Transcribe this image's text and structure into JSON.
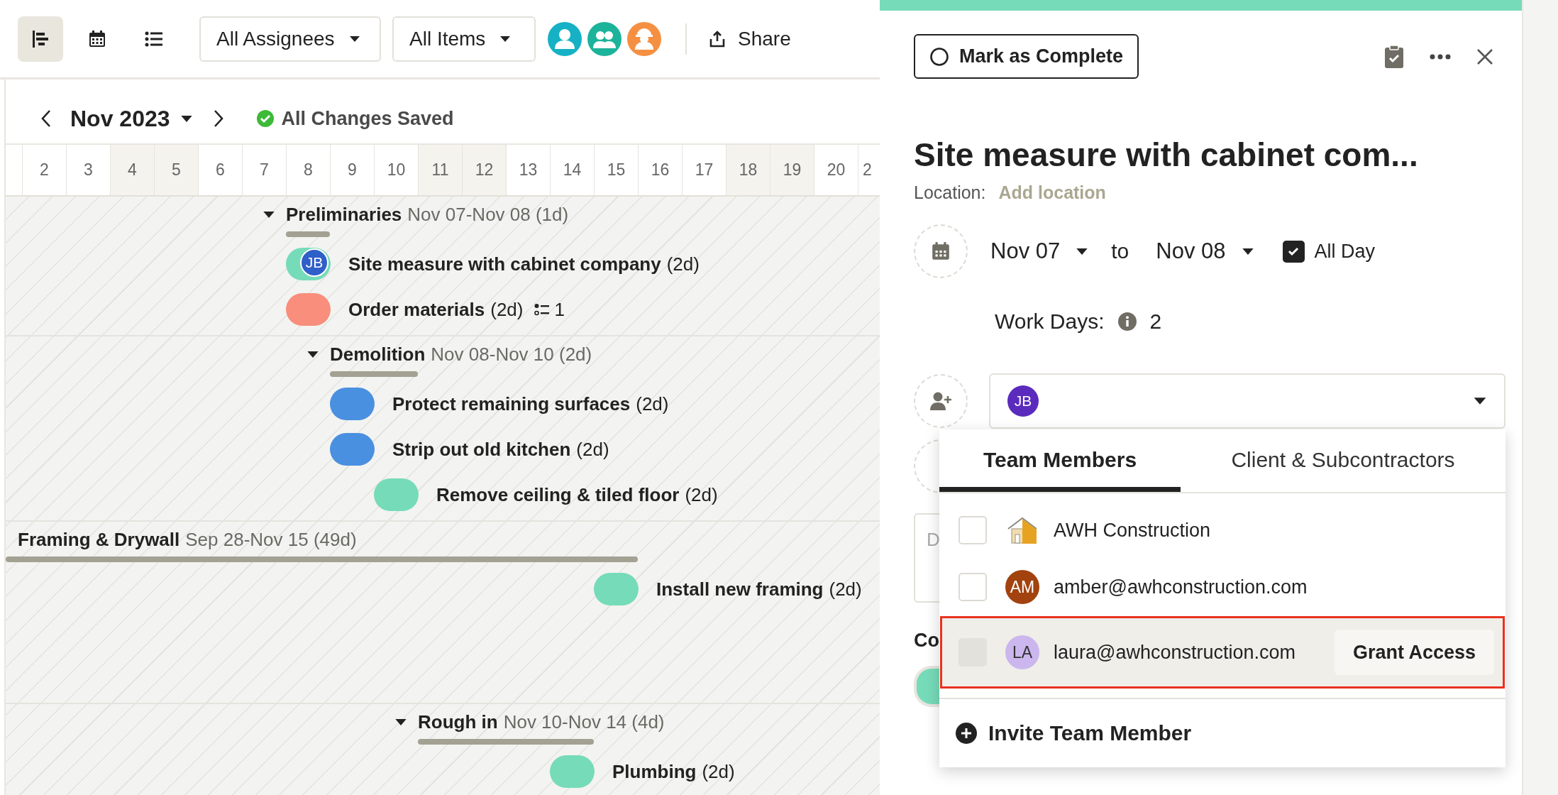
{
  "toolbar": {
    "views": [
      {
        "kind": "gantt",
        "selected": true
      },
      {
        "kind": "calendar",
        "selected": false
      },
      {
        "kind": "list",
        "selected": false
      }
    ],
    "filters": [
      "All Assignees",
      "All Items"
    ],
    "assignee_avatars": [
      {
        "kind": "person",
        "color": "#16b1c5"
      },
      {
        "kind": "team",
        "color": "#1cb39b"
      },
      {
        "kind": "worker",
        "color": "#f59042"
      }
    ],
    "share": "Share"
  },
  "nav": {
    "month": "Nov 2023",
    "save_status": "All Changes Saved"
  },
  "days": [
    {
      "label": "2",
      "weekend": false
    },
    {
      "label": "3",
      "weekend": false
    },
    {
      "label": "4",
      "weekend": true
    },
    {
      "label": "5",
      "weekend": true
    },
    {
      "label": "6",
      "weekend": false
    },
    {
      "label": "7",
      "weekend": false
    },
    {
      "label": "8",
      "weekend": false
    },
    {
      "label": "9",
      "weekend": false
    },
    {
      "label": "10",
      "weekend": false
    },
    {
      "label": "11",
      "weekend": true
    },
    {
      "label": "12",
      "weekend": true
    },
    {
      "label": "13",
      "weekend": false
    },
    {
      "label": "14",
      "weekend": false
    },
    {
      "label": "15",
      "weekend": false
    },
    {
      "label": "16",
      "weekend": false
    },
    {
      "label": "17",
      "weekend": false
    },
    {
      "label": "18",
      "weekend": true
    },
    {
      "label": "19",
      "weekend": true
    },
    {
      "label": "20",
      "weekend": false
    },
    {
      "label": "2",
      "weekend": false
    }
  ],
  "sections": [
    {
      "rows": [
        {
          "kind": "group",
          "name": "Preliminaries",
          "dates": "Nov 07-Nov 08 (1d)",
          "expanded": true
        },
        {
          "kind": "task",
          "name": "Site measure with cabinet company",
          "duration": "(2d)",
          "color": "#76dbb9",
          "assignee": {
            "initials": "JB",
            "color": "#2f5fc8"
          }
        },
        {
          "kind": "task",
          "name": "Order materials",
          "duration": "(2d)",
          "color": "#f88e7b",
          "checklist": "1"
        }
      ]
    },
    {
      "rows": [
        {
          "kind": "group",
          "name": "Demolition",
          "dates": "Nov 08-Nov 10 (2d)",
          "expanded": true
        },
        {
          "kind": "task",
          "name": "Protect remaining surfaces",
          "duration": "(2d)",
          "color": "#4a90e0",
          "at_end": false
        },
        {
          "kind": "task",
          "name": "Strip out old kitchen",
          "duration": "(2d)",
          "color": "#4a90e0",
          "at_end": false
        },
        {
          "kind": "task",
          "name": "Remove ceiling & tiled floor",
          "duration": "(2d)",
          "color": "#76dbb9",
          "at_end": true
        }
      ]
    },
    {
      "rows": [
        {
          "kind": "stage",
          "name": "Framing & Drywall",
          "dates": "Sep 28-Nov 15 (49d)"
        },
        {
          "kind": "task",
          "name": "Install new framing",
          "duration": "(2d)",
          "color": "#76dbb9",
          "at_end": true
        }
      ]
    },
    {
      "rows": [
        {
          "kind": "group",
          "name": "Rough in",
          "dates": "Nov 10-Nov 14 (4d)",
          "expanded": true
        },
        {
          "kind": "task",
          "name": "Plumbing",
          "duration": "(2d)",
          "color": "#76dbb9",
          "at_end": true
        }
      ]
    }
  ],
  "panel": {
    "complete_button": "Mark as Complete",
    "title": "Site measure with cabinet com...",
    "location_label": "Location:",
    "location_link": "Add location",
    "start_date": "Nov 07",
    "to": "to",
    "end_date": "Nov 08",
    "all_day": {
      "label": "All Day",
      "checked": true
    },
    "work_days_label": "Work Days:",
    "work_days": "2",
    "assignees": [
      {
        "initials": "JB",
        "color": "#5b2bbd"
      }
    ],
    "description_placeholder": "D",
    "section_label": "Co"
  },
  "assignee_menu": {
    "tabs": [
      {
        "label": "Team Members",
        "selected": true
      },
      {
        "label": "Client & Subcontractors",
        "selected": false
      }
    ],
    "members": [
      {
        "kind": "company",
        "name": "AWH Construction",
        "checked": false,
        "disabled": false,
        "highlighted": false
      },
      {
        "kind": "person",
        "initials": "AM",
        "color": "#a2420e",
        "name": "amber@awhconstruction.com",
        "checked": false,
        "disabled": false,
        "highlighted": false
      },
      {
        "kind": "person",
        "initials": "LA",
        "color": "#cbb6ee",
        "name": "laura@awhconstruction.com",
        "checked": false,
        "disabled": true,
        "highlighted": true,
        "action": "Grant Access"
      }
    ],
    "invite": "Invite Team Member"
  }
}
